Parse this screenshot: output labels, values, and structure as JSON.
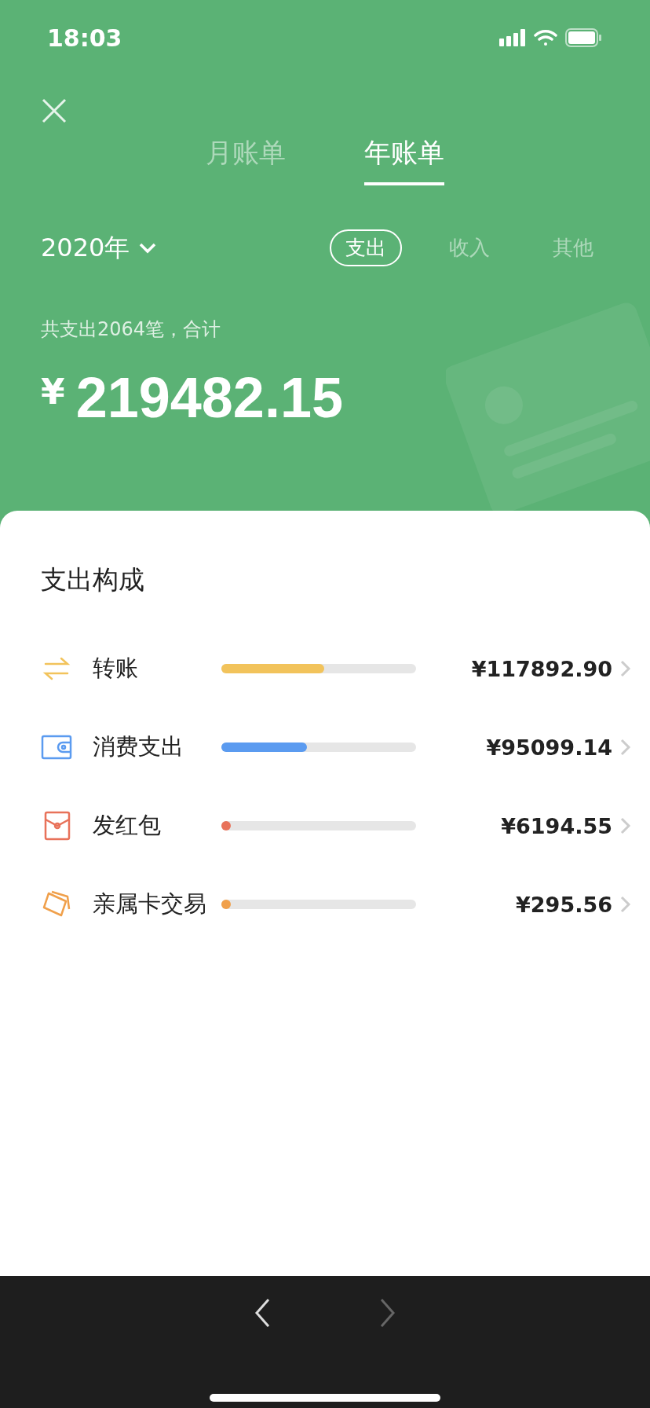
{
  "status_bar": {
    "time": "18:03"
  },
  "tabs": [
    {
      "label": "月账单",
      "selected": false
    },
    {
      "label": "年账单",
      "selected": true
    }
  ],
  "year_picker": {
    "value": "2020年"
  },
  "filters": [
    {
      "label": "支出",
      "selected": true
    },
    {
      "label": "收入",
      "selected": false
    },
    {
      "label": "其他",
      "selected": false
    }
  ],
  "summary": {
    "caption": "共支出2064笔，合计",
    "currency": "¥",
    "total": "219482.15"
  },
  "breakdown": {
    "title": "支出构成",
    "items": [
      {
        "kind": "transfer",
        "label": "转账",
        "color": "#f2c35b",
        "level": 0.53,
        "amount": "¥117892.90"
      },
      {
        "kind": "wallet",
        "label": "消费支出",
        "color": "#5b9bf0",
        "level": 0.44,
        "amount": "¥95099.14"
      },
      {
        "kind": "envelope",
        "label": "发红包",
        "color": "#e8725a",
        "level": 0.04,
        "amount": "¥6194.55"
      },
      {
        "kind": "card",
        "label": "亲属卡交易",
        "color": "#f0a04b",
        "level": 0.04,
        "amount": "¥295.56"
      }
    ]
  },
  "nav": {
    "back_disabled": false,
    "forward_disabled": true
  }
}
